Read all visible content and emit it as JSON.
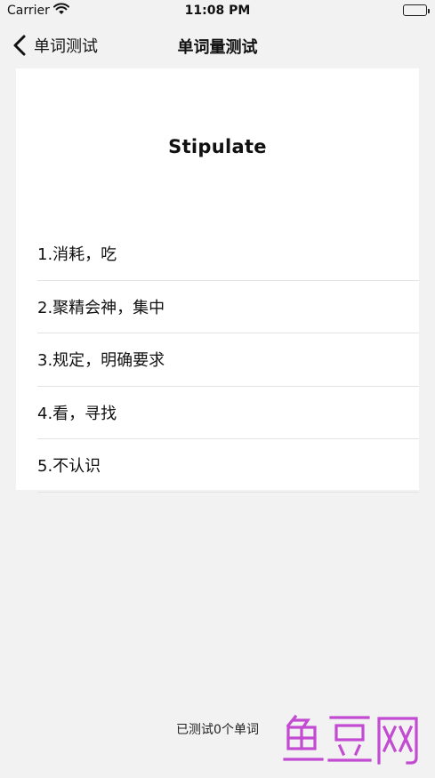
{
  "status_bar": {
    "carrier": "Carrier",
    "time": "11:08 PM",
    "battery_level": 1.0
  },
  "nav": {
    "back_label": "单词测试",
    "title": "单词量测试"
  },
  "quiz": {
    "word": "Stipulate",
    "options": [
      "1.消耗，吃",
      "2.聚精会神，集中",
      "3.规定，明确要求",
      "4.看，寻找",
      "5.不认识"
    ]
  },
  "footer": {
    "tested_count": "已测试0个单词"
  },
  "watermark": {
    "text": "鱼豆网",
    "color": "#c24bd2"
  },
  "colors": {
    "background": "#f2f2f2",
    "card": "#ffffff",
    "divider": "#e3e3e3"
  }
}
